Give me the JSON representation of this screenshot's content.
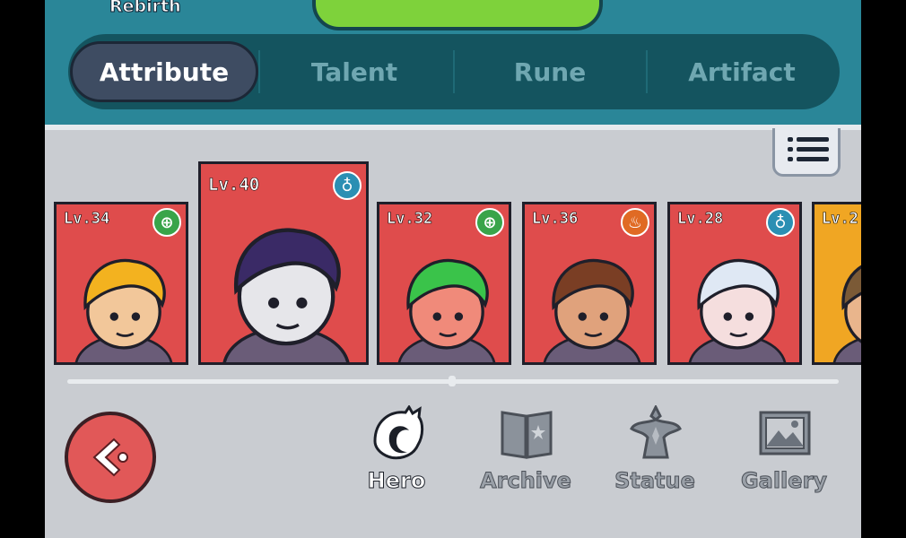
{
  "header": {
    "rebirth_label": "Rebirth"
  },
  "tabs": [
    {
      "label": "Attribute",
      "active": true
    },
    {
      "label": "Talent",
      "active": false
    },
    {
      "label": "Rune",
      "active": false
    },
    {
      "label": "Artifact",
      "active": false
    }
  ],
  "heroes": [
    {
      "level": "Lv.34",
      "badge_icon": "nature-icon",
      "badge_color": "#39a44a",
      "frame": "red",
      "skin": "#f2c79a",
      "hair": "#f3b21f"
    },
    {
      "level": "Lv.40",
      "badge_icon": "water-icon",
      "badge_color": "#2b8fb3",
      "frame": "red",
      "skin": "#e6e6ea",
      "hair": "#3a2a66"
    },
    {
      "level": "Lv.32",
      "badge_icon": "nature-icon",
      "badge_color": "#39a44a",
      "frame": "red",
      "skin": "#f08a7a",
      "hair": "#3ac34a"
    },
    {
      "level": "Lv.36",
      "badge_icon": "fire-icon",
      "badge_color": "#e06a24",
      "frame": "red",
      "skin": "#e0a27c",
      "hair": "#7a3e24"
    },
    {
      "level": "Lv.28",
      "badge_icon": "water-icon",
      "badge_color": "#2b8fb3",
      "frame": "red",
      "skin": "#f5dede",
      "hair": "#dfe8f4"
    },
    {
      "level": "Lv.2",
      "badge_icon": "",
      "badge_color": "",
      "frame": "gold",
      "skin": "#e9b58c",
      "hair": "#7b5a36"
    }
  ],
  "nav": [
    {
      "label": "Hero",
      "icon": "hero-icon",
      "active": true
    },
    {
      "label": "Archive",
      "icon": "book-icon",
      "active": false
    },
    {
      "label": "Statue",
      "icon": "statue-icon",
      "active": false
    },
    {
      "label": "Gallery",
      "icon": "gallery-icon",
      "active": false
    }
  ]
}
